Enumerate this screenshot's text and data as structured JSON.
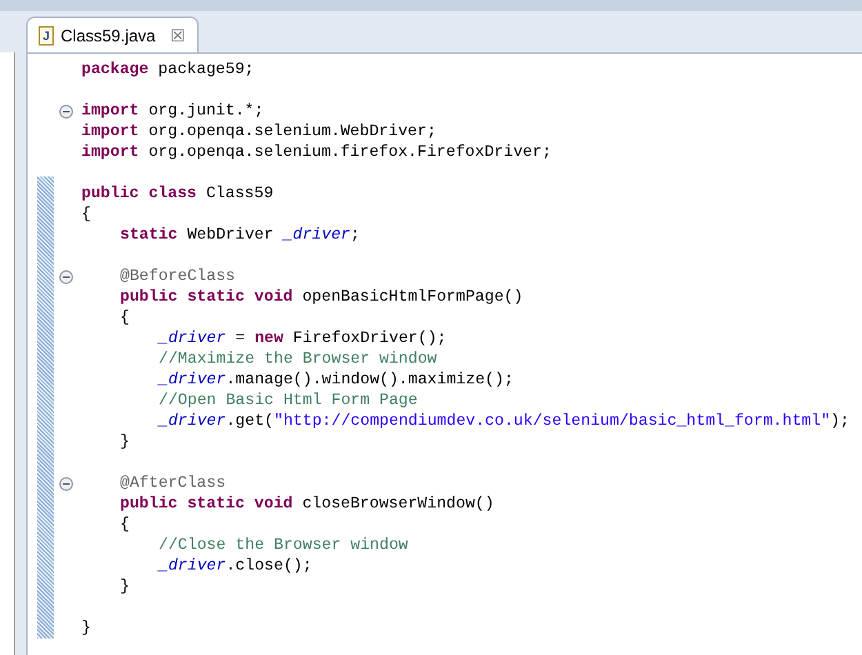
{
  "editor_tab": {
    "icon_text": "J",
    "title": "Class59.java",
    "close": "☒",
    "selected": true
  },
  "lines": [
    {
      "kind": "code",
      "tokens": [
        {
          "kind": "keyword",
          "text": "package"
        },
        {
          "kind": "plain",
          "text": " package59;"
        }
      ]
    },
    {
      "kind": "blank"
    },
    {
      "kind": "code",
      "expanded": true,
      "tokens": [
        {
          "kind": "keyword",
          "text": "import"
        },
        {
          "kind": "plain",
          "text": " org.junit.*;"
        }
      ]
    },
    {
      "kind": "code",
      "tokens": [
        {
          "kind": "keyword",
          "text": "import"
        },
        {
          "kind": "plain",
          "text": " org.openqa.selenium.WebDriver;"
        }
      ]
    },
    {
      "kind": "code",
      "tokens": [
        {
          "kind": "keyword",
          "text": "import"
        },
        {
          "kind": "plain",
          "text": " org.openqa.selenium.firefox.FirefoxDriver;"
        }
      ]
    },
    {
      "kind": "blank"
    },
    {
      "kind": "code",
      "tokens": [
        {
          "kind": "keyword",
          "text": "public class"
        },
        {
          "kind": "plain",
          "text": " Class59"
        }
      ]
    },
    {
      "kind": "code",
      "tokens": [
        {
          "kind": "plain",
          "text": "{"
        }
      ],
      "children": [
        {
          "kind": "code",
          "tokens": [
            {
              "kind": "keyword",
              "text": "static"
            },
            {
              "kind": "plain",
              "text": " WebDriver "
            },
            {
              "kind": "field",
              "text": "_driver"
            },
            {
              "kind": "plain",
              "text": ";"
            }
          ]
        },
        {
          "kind": "blank"
        },
        {
          "kind": "code",
          "expanded": true,
          "tokens": [
            {
              "kind": "annotation",
              "text": "@BeforeClass"
            }
          ]
        },
        {
          "kind": "code",
          "tokens": [
            {
              "kind": "keyword",
              "text": "public static void"
            },
            {
              "kind": "plain",
              "text": " openBasicHtmlFormPage()"
            }
          ]
        },
        {
          "kind": "code",
          "tokens": [
            {
              "kind": "plain",
              "text": "{"
            }
          ],
          "children": [
            {
              "kind": "code",
              "tokens": [
                {
                  "kind": "field",
                  "text": "_driver"
                },
                {
                  "kind": "plain",
                  "text": " = "
                },
                {
                  "kind": "keyword",
                  "text": "new"
                },
                {
                  "kind": "plain",
                  "text": " FirefoxDriver();"
                }
              ]
            },
            {
              "kind": "code",
              "tokens": [
                {
                  "kind": "comment",
                  "text": "//Maximize the Browser window"
                }
              ]
            },
            {
              "kind": "code",
              "tokens": [
                {
                  "kind": "field",
                  "text": "_driver"
                },
                {
                  "kind": "plain",
                  "text": ".manage().window().maximize();"
                }
              ]
            },
            {
              "kind": "code",
              "tokens": [
                {
                  "kind": "comment",
                  "text": "//Open Basic Html Form Page"
                }
              ]
            },
            {
              "kind": "code",
              "tokens": [
                {
                  "kind": "field",
                  "text": "_driver"
                },
                {
                  "kind": "plain",
                  "text": ".get("
                },
                {
                  "kind": "string",
                  "text": "\"http://compendiumdev.co.uk/selenium/basic_html_form.html\""
                },
                {
                  "kind": "plain",
                  "text": ");"
                }
              ]
            }
          ]
        },
        {
          "kind": "code",
          "tokens": [
            {
              "kind": "plain",
              "text": "}"
            }
          ]
        },
        {
          "kind": "blank"
        },
        {
          "kind": "code",
          "expanded": true,
          "tokens": [
            {
              "kind": "annotation",
              "text": "@AfterClass"
            }
          ]
        },
        {
          "kind": "code",
          "tokens": [
            {
              "kind": "keyword",
              "text": "public static void"
            },
            {
              "kind": "plain",
              "text": " closeBrowserWindow()"
            }
          ]
        },
        {
          "kind": "code",
          "tokens": [
            {
              "kind": "plain",
              "text": "{"
            }
          ],
          "children": [
            {
              "kind": "code",
              "tokens": [
                {
                  "kind": "comment",
                  "text": "//Close the Browser window"
                }
              ]
            },
            {
              "kind": "code",
              "tokens": [
                {
                  "kind": "field",
                  "text": "_driver"
                },
                {
                  "kind": "plain",
                  "text": ".close();"
                }
              ]
            }
          ]
        },
        {
          "kind": "code",
          "tokens": [
            {
              "kind": "plain",
              "text": "}"
            }
          ]
        },
        {
          "kind": "blank"
        }
      ]
    },
    {
      "kind": "code",
      "tokens": [
        {
          "kind": "plain",
          "text": "}"
        }
      ]
    }
  ]
}
